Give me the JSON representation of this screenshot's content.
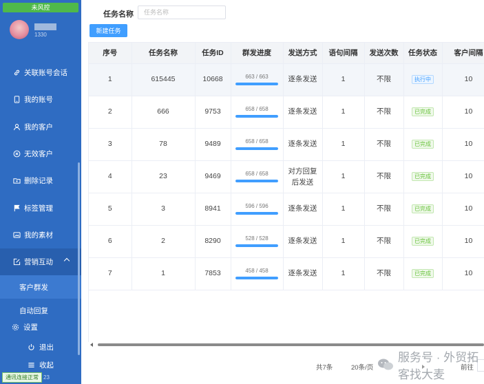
{
  "sidebar": {
    "risk_badge": "未风控",
    "user_sub": "1330",
    "nav": [
      {
        "label": "关联账号会话",
        "icon": "link-icon"
      },
      {
        "label": "我的账号",
        "icon": "phone-icon"
      },
      {
        "label": "我的客户",
        "icon": "user-icon"
      },
      {
        "label": "无效客户",
        "icon": "close-circle-icon"
      },
      {
        "label": "删除记录",
        "icon": "folder-delete-icon"
      },
      {
        "label": "标签管理",
        "icon": "flag-icon"
      },
      {
        "label": "我的素材",
        "icon": "image-icon"
      },
      {
        "label": "营销互动",
        "icon": "edit-icon"
      }
    ],
    "sub_items": [
      "客户群发",
      "自动回复"
    ],
    "settings": "设置",
    "logout": "退出",
    "collapse": "收起",
    "status": "通讯连接正常",
    "status_tail": "23"
  },
  "filter": {
    "label": "任务名称",
    "placeholder": "任务名称"
  },
  "toolbar": {
    "new_task": "新建任务"
  },
  "table": {
    "headers": [
      "序号",
      "任务名称",
      "任务ID",
      "群发进度",
      "发送方式",
      "语句间隔",
      "发送次数",
      "任务状态",
      "客户间隔"
    ],
    "rows": [
      {
        "no": "1",
        "name": "615445",
        "id": "10668",
        "progress_text": "663 / 663",
        "progress": 1.0,
        "method": "逐条发送",
        "interval": "1",
        "times": "不限",
        "status": "执行中",
        "status_type": "run",
        "client_interval": "10"
      },
      {
        "no": "2",
        "name": "666",
        "id": "9753",
        "progress_text": "658 / 658",
        "progress": 1.0,
        "method": "逐条发送",
        "interval": "1",
        "times": "不限",
        "status": "已完成",
        "status_type": "done",
        "client_interval": "10"
      },
      {
        "no": "3",
        "name": "78",
        "id": "9489",
        "progress_text": "658 / 658",
        "progress": 1.0,
        "method": "逐条发送",
        "interval": "1",
        "times": "不限",
        "status": "已完成",
        "status_type": "done",
        "client_interval": "10"
      },
      {
        "no": "4",
        "name": "23",
        "id": "9469",
        "progress_text": "658 / 658",
        "progress": 1.0,
        "method": "对方回复后发送",
        "interval": "1",
        "times": "不限",
        "status": "已完成",
        "status_type": "done",
        "client_interval": "10"
      },
      {
        "no": "5",
        "name": "3",
        "id": "8941",
        "progress_text": "596 / 596",
        "progress": 1.0,
        "method": "逐条发送",
        "interval": "1",
        "times": "不限",
        "status": "已完成",
        "status_type": "done",
        "client_interval": "10"
      },
      {
        "no": "6",
        "name": "2",
        "id": "8290",
        "progress_text": "528 / 528",
        "progress": 1.0,
        "method": "逐条发送",
        "interval": "1",
        "times": "不限",
        "status": "已完成",
        "status_type": "done",
        "client_interval": "10"
      },
      {
        "no": "7",
        "name": "1",
        "id": "7853",
        "progress_text": "458 / 458",
        "progress": 1.0,
        "method": "逐条发送",
        "interval": "1",
        "times": "不限",
        "status": "已完成",
        "status_type": "done",
        "client_interval": "10"
      }
    ]
  },
  "pager": {
    "total": "共7条",
    "page_size": "20条/页",
    "goto": "前往"
  },
  "watermark": "服务号 · 外贸拓客找大麦",
  "colors": {
    "sidebar": "#2f6cc2",
    "primary": "#409eff",
    "success": "#67c23a"
  }
}
